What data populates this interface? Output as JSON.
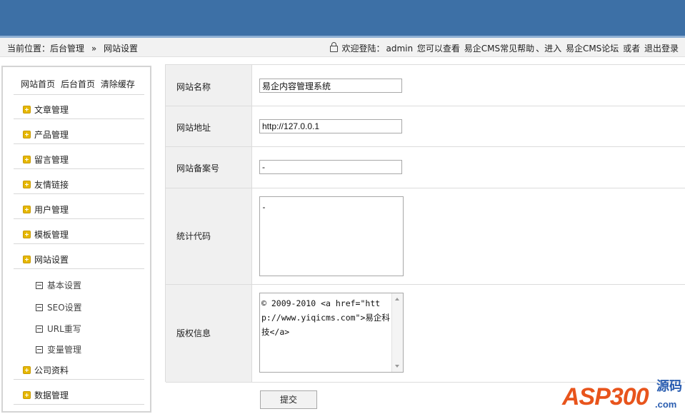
{
  "breadcrumb": {
    "prefix": "当前位置：后台管理",
    "separator": "»",
    "current": "网站设置"
  },
  "welcome": {
    "text": "欢迎登陆：",
    "user": "admin",
    "mid": "您可以查看",
    "help_link": "易企CMS常见帮助",
    "join": "、进入",
    "forum_link": "易企CMS论坛",
    "or": "或者",
    "logout_link": "退出登录"
  },
  "sidebar": {
    "top_links": [
      "网站首页",
      "后台首页",
      "清除缓存"
    ],
    "items": [
      {
        "label": "文章管理"
      },
      {
        "label": "产品管理"
      },
      {
        "label": "留言管理"
      },
      {
        "label": "友情链接"
      },
      {
        "label": "用户管理"
      },
      {
        "label": "模板管理"
      },
      {
        "label": "网站设置"
      },
      {
        "label": "公司资料"
      },
      {
        "label": "数据管理"
      }
    ],
    "sub_items": [
      "基本设置",
      "SEO设置",
      "URL重写",
      "变量管理"
    ]
  },
  "form": {
    "site_name_label": "网站名称",
    "site_name_value": "易企内容管理系统",
    "site_url_label": "网站地址",
    "site_url_value": "http://127.0.0.1",
    "icp_label": "网站备案号",
    "icp_value": "-",
    "stats_label": "统计代码",
    "stats_value": "-",
    "copyright_label": "版权信息",
    "copyright_value": "© 2009-2010 <a href=\"http://www.yiqicms.com\">易企科技</a>"
  },
  "submit_label": "提交",
  "watermark": {
    "brand": "ASP300",
    "cn": "源码",
    "domain": ".com"
  },
  "colors": {
    "header": "#3d70a6",
    "accent_icon": "#e6b800",
    "watermark_orange": "#e8541c",
    "watermark_blue": "#2a5db0"
  }
}
